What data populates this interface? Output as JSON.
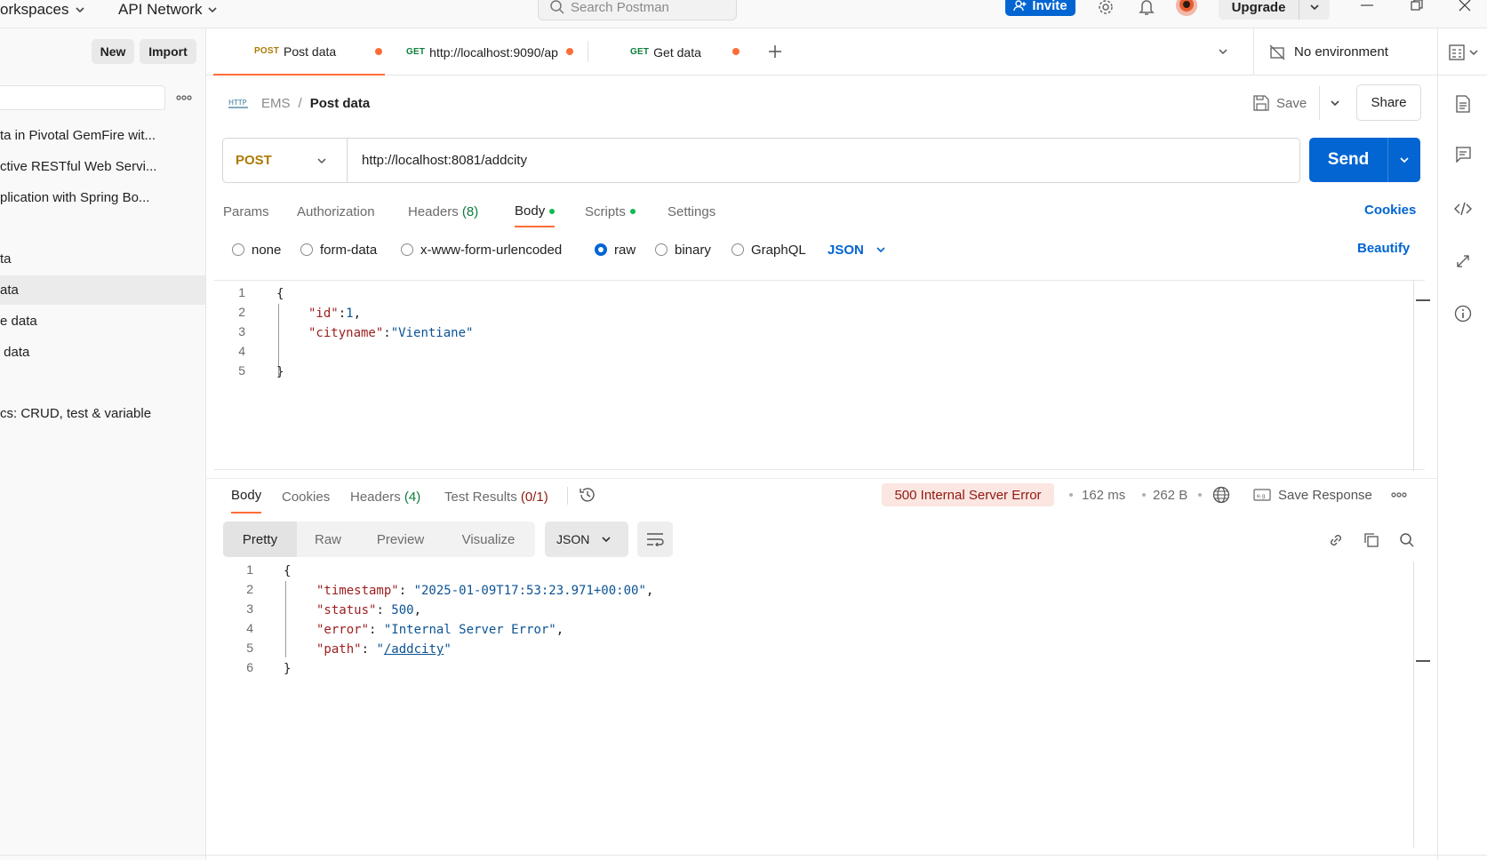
{
  "topbar": {
    "workspaces": "orkspaces",
    "api_network": "API Network",
    "search_placeholder": "Search Postman",
    "invite": "Invite",
    "upgrade": "Upgrade"
  },
  "sidebar": {
    "new_label": "New",
    "import_label": "Import",
    "items": [
      "ta in Pivotal GemFire wit...",
      "ctive RESTful Web Servi...",
      "plication with Spring Bo...",
      "ta",
      "ata",
      "e data",
      " data",
      "cs: CRUD, test & variable"
    ]
  },
  "tabs": [
    {
      "method": "POST",
      "method_color": "#ad7a03",
      "label": "Post data"
    },
    {
      "method": "GET",
      "method_color": "#0c7d3c",
      "label": "http://localhost:9090/ap"
    },
    {
      "method": "GET",
      "method_color": "#0c7d3c",
      "label": "Get data"
    }
  ],
  "environment": "No environment",
  "breadcrumb": {
    "collection": "EMS",
    "separator": "/",
    "request": "Post data"
  },
  "header": {
    "save": "Save",
    "share": "Share"
  },
  "request": {
    "method": "POST",
    "url": "http://localhost:8081/addcity",
    "send": "Send",
    "tabs": {
      "params": "Params",
      "authorization": "Authorization",
      "headers": "Headers",
      "headers_count": "(8)",
      "body": "Body",
      "scripts": "Scripts",
      "settings": "Settings"
    },
    "cookies": "Cookies",
    "body_types": [
      "none",
      "form-data",
      "x-www-form-urlencoded",
      "raw",
      "binary",
      "GraphQL"
    ],
    "body_format": "JSON",
    "beautify": "Beautify",
    "body_lines": [
      "1",
      "2",
      "3",
      "4",
      "5"
    ],
    "body_json": {
      "open": "{",
      "id_key": "\"id\"",
      "id_colon": ":",
      "id_val": "1",
      "comma": ",",
      "city_key": "\"cityname\"",
      "city_colon": ":",
      "city_val": "\"Vientiane\"",
      "close": "}"
    }
  },
  "response": {
    "tabs": {
      "body": "Body",
      "cookies": "Cookies",
      "headers": "Headers",
      "headers_count": "(4)",
      "tests": "Test Results",
      "tests_count": "(0/1)"
    },
    "status": "500 Internal Server Error",
    "time": "162 ms",
    "size": "262 B",
    "save_response": "Save Response",
    "formats": [
      "Pretty",
      "Raw",
      "Preview",
      "Visualize"
    ],
    "format_select": "JSON",
    "lines": [
      "1",
      "2",
      "3",
      "4",
      "5",
      "6"
    ],
    "json": {
      "open": "{",
      "timestamp_key": "\"timestamp\"",
      "timestamp_val": "\"2025-01-09T17:53:23.971+00:00\"",
      "status_key": "\"status\"",
      "status_val": "500",
      "error_key": "\"error\"",
      "error_val": "\"Internal Server Error\"",
      "path_key": "\"path\"",
      "path_q1": "\"",
      "path_val": "/addcity",
      "path_q2": "\"",
      "sep": ": ",
      "comma": ",",
      "close": "}"
    }
  }
}
